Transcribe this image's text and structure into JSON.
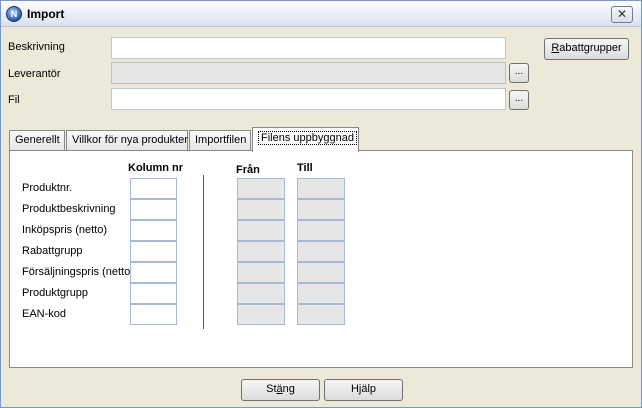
{
  "window": {
    "title": "Import",
    "app_icon_letter": "N",
    "close_symbol": "✕"
  },
  "form": {
    "beskrivning_label": "Beskrivning",
    "beskrivning_value": "",
    "leverantor_label": "Leverantör",
    "leverantor_value": "",
    "fil_label": "Fil",
    "fil_value": "",
    "browse_label": "..."
  },
  "rabatt_button": {
    "accel": "R",
    "rest": "abattgrupper"
  },
  "tabs": [
    {
      "label": "Generellt"
    },
    {
      "label": "Villkor för nya produkter"
    },
    {
      "label": "Importfilen"
    },
    {
      "label": "Filens uppbyggnad",
      "active": true
    }
  ],
  "layout_tab": {
    "col_kolumn": "Kolumn nr",
    "col_fran": "Från",
    "col_till": "Till",
    "rows": [
      {
        "label": "Produktnr."
      },
      {
        "label": "Produktbeskrivning"
      },
      {
        "label": "Inköpspris (netto)"
      },
      {
        "label": "Rabattgrupp"
      },
      {
        "label": "Försäljningspris (netto)"
      },
      {
        "label": "Produktgrupp"
      },
      {
        "label": "EAN-kod"
      }
    ]
  },
  "footer": {
    "stang": {
      "pre": "St",
      "accel": "ä",
      "post": "ng"
    },
    "hjalp": {
      "pre": "H",
      "accel": "j",
      "post": "älp"
    }
  }
}
